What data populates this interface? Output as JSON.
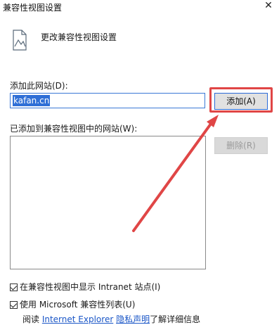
{
  "window": {
    "title": "兼容性视图设置",
    "close_icon": "close-icon"
  },
  "header": {
    "icon": "compat-view-icon",
    "text": "更改兼容性视图设置"
  },
  "add_site": {
    "label": "添加此网站(D):",
    "value": "kafan.cn",
    "add_button": "添加(A)"
  },
  "site_list": {
    "label": "已添加到兼容性视图中的网站(W):",
    "remove_button": "删除(R)",
    "items": []
  },
  "options": {
    "intranet_label": "在兼容性视图中显示 Intranet 站点(I)",
    "intranet_checked": true,
    "ms_list_label": "使用 Microsoft 兼容性列表(U)",
    "ms_list_checked": true
  },
  "footer": {
    "prefix": "阅读 ",
    "link1": "Internet Explorer",
    "link2": "隐私声明",
    "suffix": "了解详细信息"
  },
  "annotation": {
    "color": "#e04646"
  }
}
